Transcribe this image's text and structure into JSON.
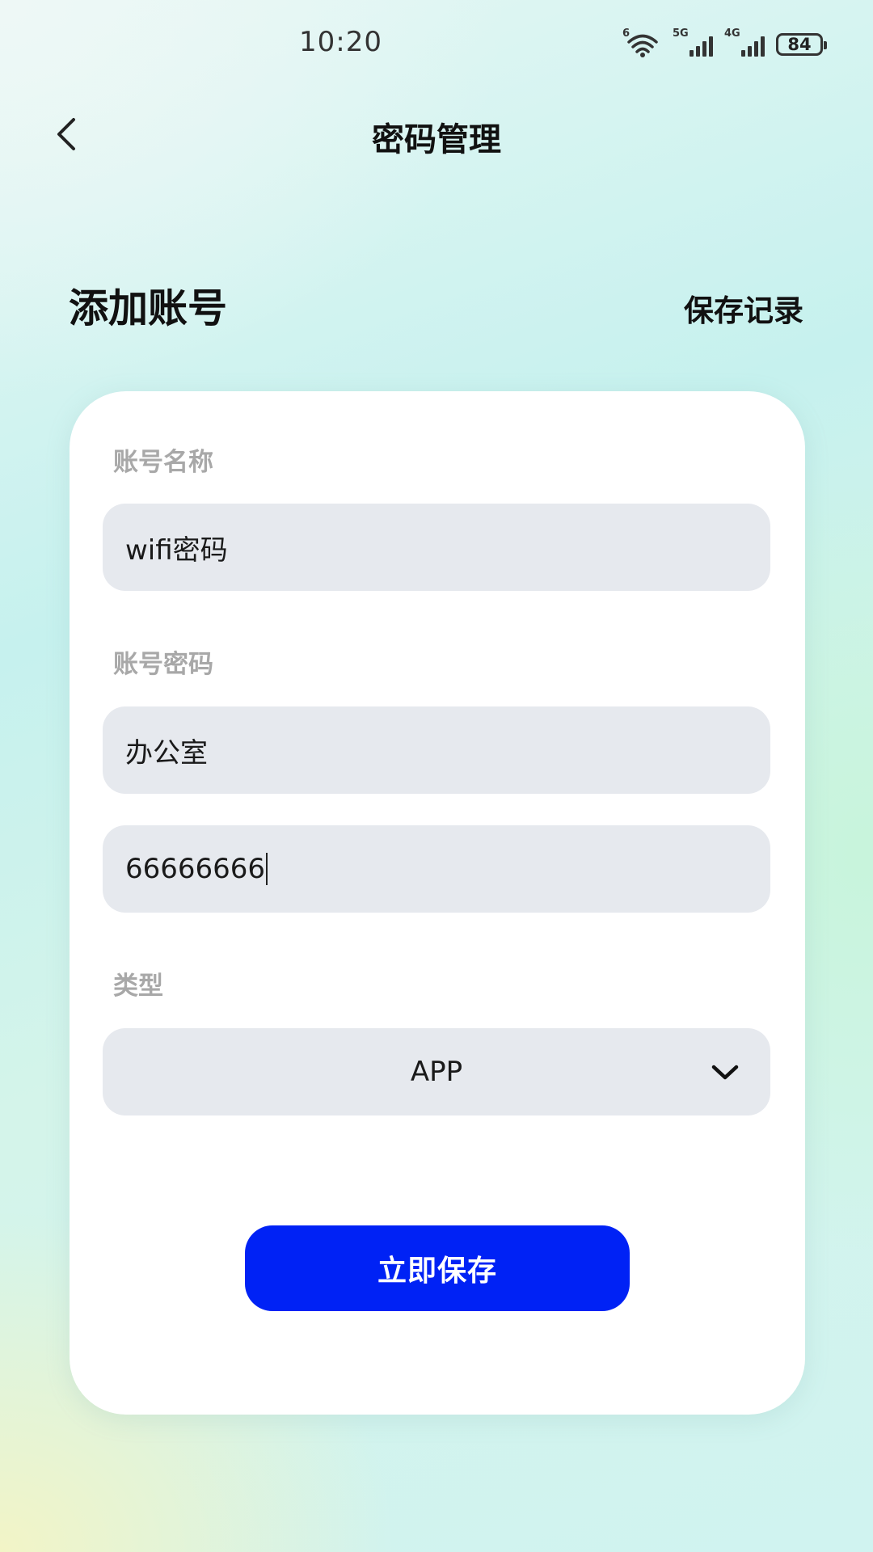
{
  "status_bar": {
    "time": "10:20",
    "wifi_label": "6",
    "signal_1_label": "5G",
    "signal_2_label": "4G",
    "battery": "84"
  },
  "nav": {
    "back_icon": "chevron-left-icon",
    "title": "密码管理"
  },
  "section": {
    "title": "添加账号",
    "history_link": "保存记录"
  },
  "form": {
    "account_name_label": "账号名称",
    "account_name_value": "wifi密码",
    "account_password_label": "账号密码",
    "account_field_value": "办公室",
    "password_value": "66666666",
    "type_label": "类型",
    "type_value": "APP",
    "type_dropdown_icon": "chevron-down-icon",
    "save_button": "立即保存"
  },
  "colors": {
    "primary_button": "#0022f5",
    "input_background": "#e6e9ee",
    "label_gray": "#a8a8a8"
  }
}
